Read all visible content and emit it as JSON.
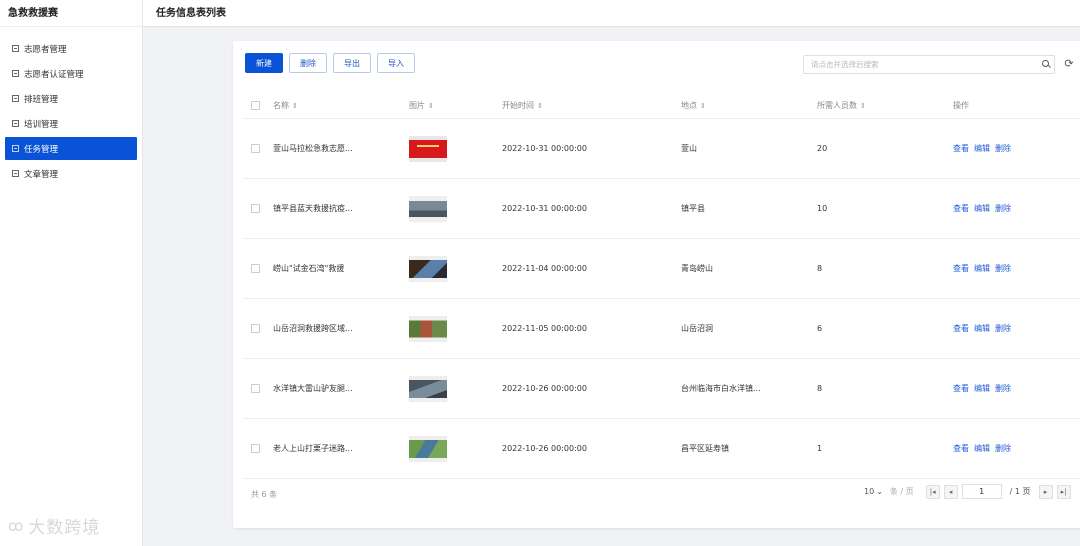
{
  "app": {
    "title": "急救救援赛"
  },
  "sidebar": {
    "items": [
      {
        "label": "志愿者管理",
        "active": false
      },
      {
        "label": "志愿者认证管理",
        "active": false
      },
      {
        "label": "排班管理",
        "active": false
      },
      {
        "label": "培训管理",
        "active": false
      },
      {
        "label": "任务管理",
        "active": true
      },
      {
        "label": "文章管理",
        "active": false
      }
    ]
  },
  "header": {
    "title": "任务信息表列表"
  },
  "toolbar": {
    "new_label": "新建",
    "delete_label": "删除",
    "export_label": "导出",
    "import_label": "导入"
  },
  "search": {
    "placeholder": "请点击并选择后搜索",
    "value": ""
  },
  "table": {
    "columns": {
      "name": "名称",
      "image": "图片",
      "start_time": "开始时间",
      "location": "地点",
      "people": "所需人员数",
      "actions": "操作"
    },
    "actions": {
      "view": "查看",
      "edit": "编辑",
      "delete": "删除"
    },
    "rows": [
      {
        "name": "萱山马拉松急救志愿...",
        "start_time": "2022-10-31 00:00:00",
        "location": "萱山",
        "people": "20"
      },
      {
        "name": "镇平县蓝天救援抗疫...",
        "start_time": "2022-10-31 00:00:00",
        "location": "镇平县",
        "people": "10"
      },
      {
        "name": "崂山\"试金石湾\"救援",
        "start_time": "2022-11-04 00:00:00",
        "location": "青岛崂山",
        "people": "8"
      },
      {
        "name": "山岳沼洞救援跨区域...",
        "start_time": "2022-11-05 00:00:00",
        "location": "山岳沼洞",
        "people": "6"
      },
      {
        "name": "水洋镇大雷山驴友腿...",
        "start_time": "2022-10-26 00:00:00",
        "location": "台州临海市白水洋镇...",
        "people": "8"
      },
      {
        "name": "老人上山打栗子迷路...",
        "start_time": "2022-10-26 00:00:00",
        "location": "昌平区延寿镇",
        "people": "1"
      }
    ]
  },
  "footer": {
    "total_text": "共 6 条",
    "page_size": "10",
    "per_page_label": "条 / 页",
    "current_page": "1",
    "total_pages_text": "/ 1 页"
  },
  "watermark": {
    "text": "大数跨境"
  },
  "colors": {
    "primary": "#0a52d6",
    "link": "#1f5bd1"
  },
  "icons": {
    "refresh": "refresh-icon",
    "search": "search-icon"
  }
}
